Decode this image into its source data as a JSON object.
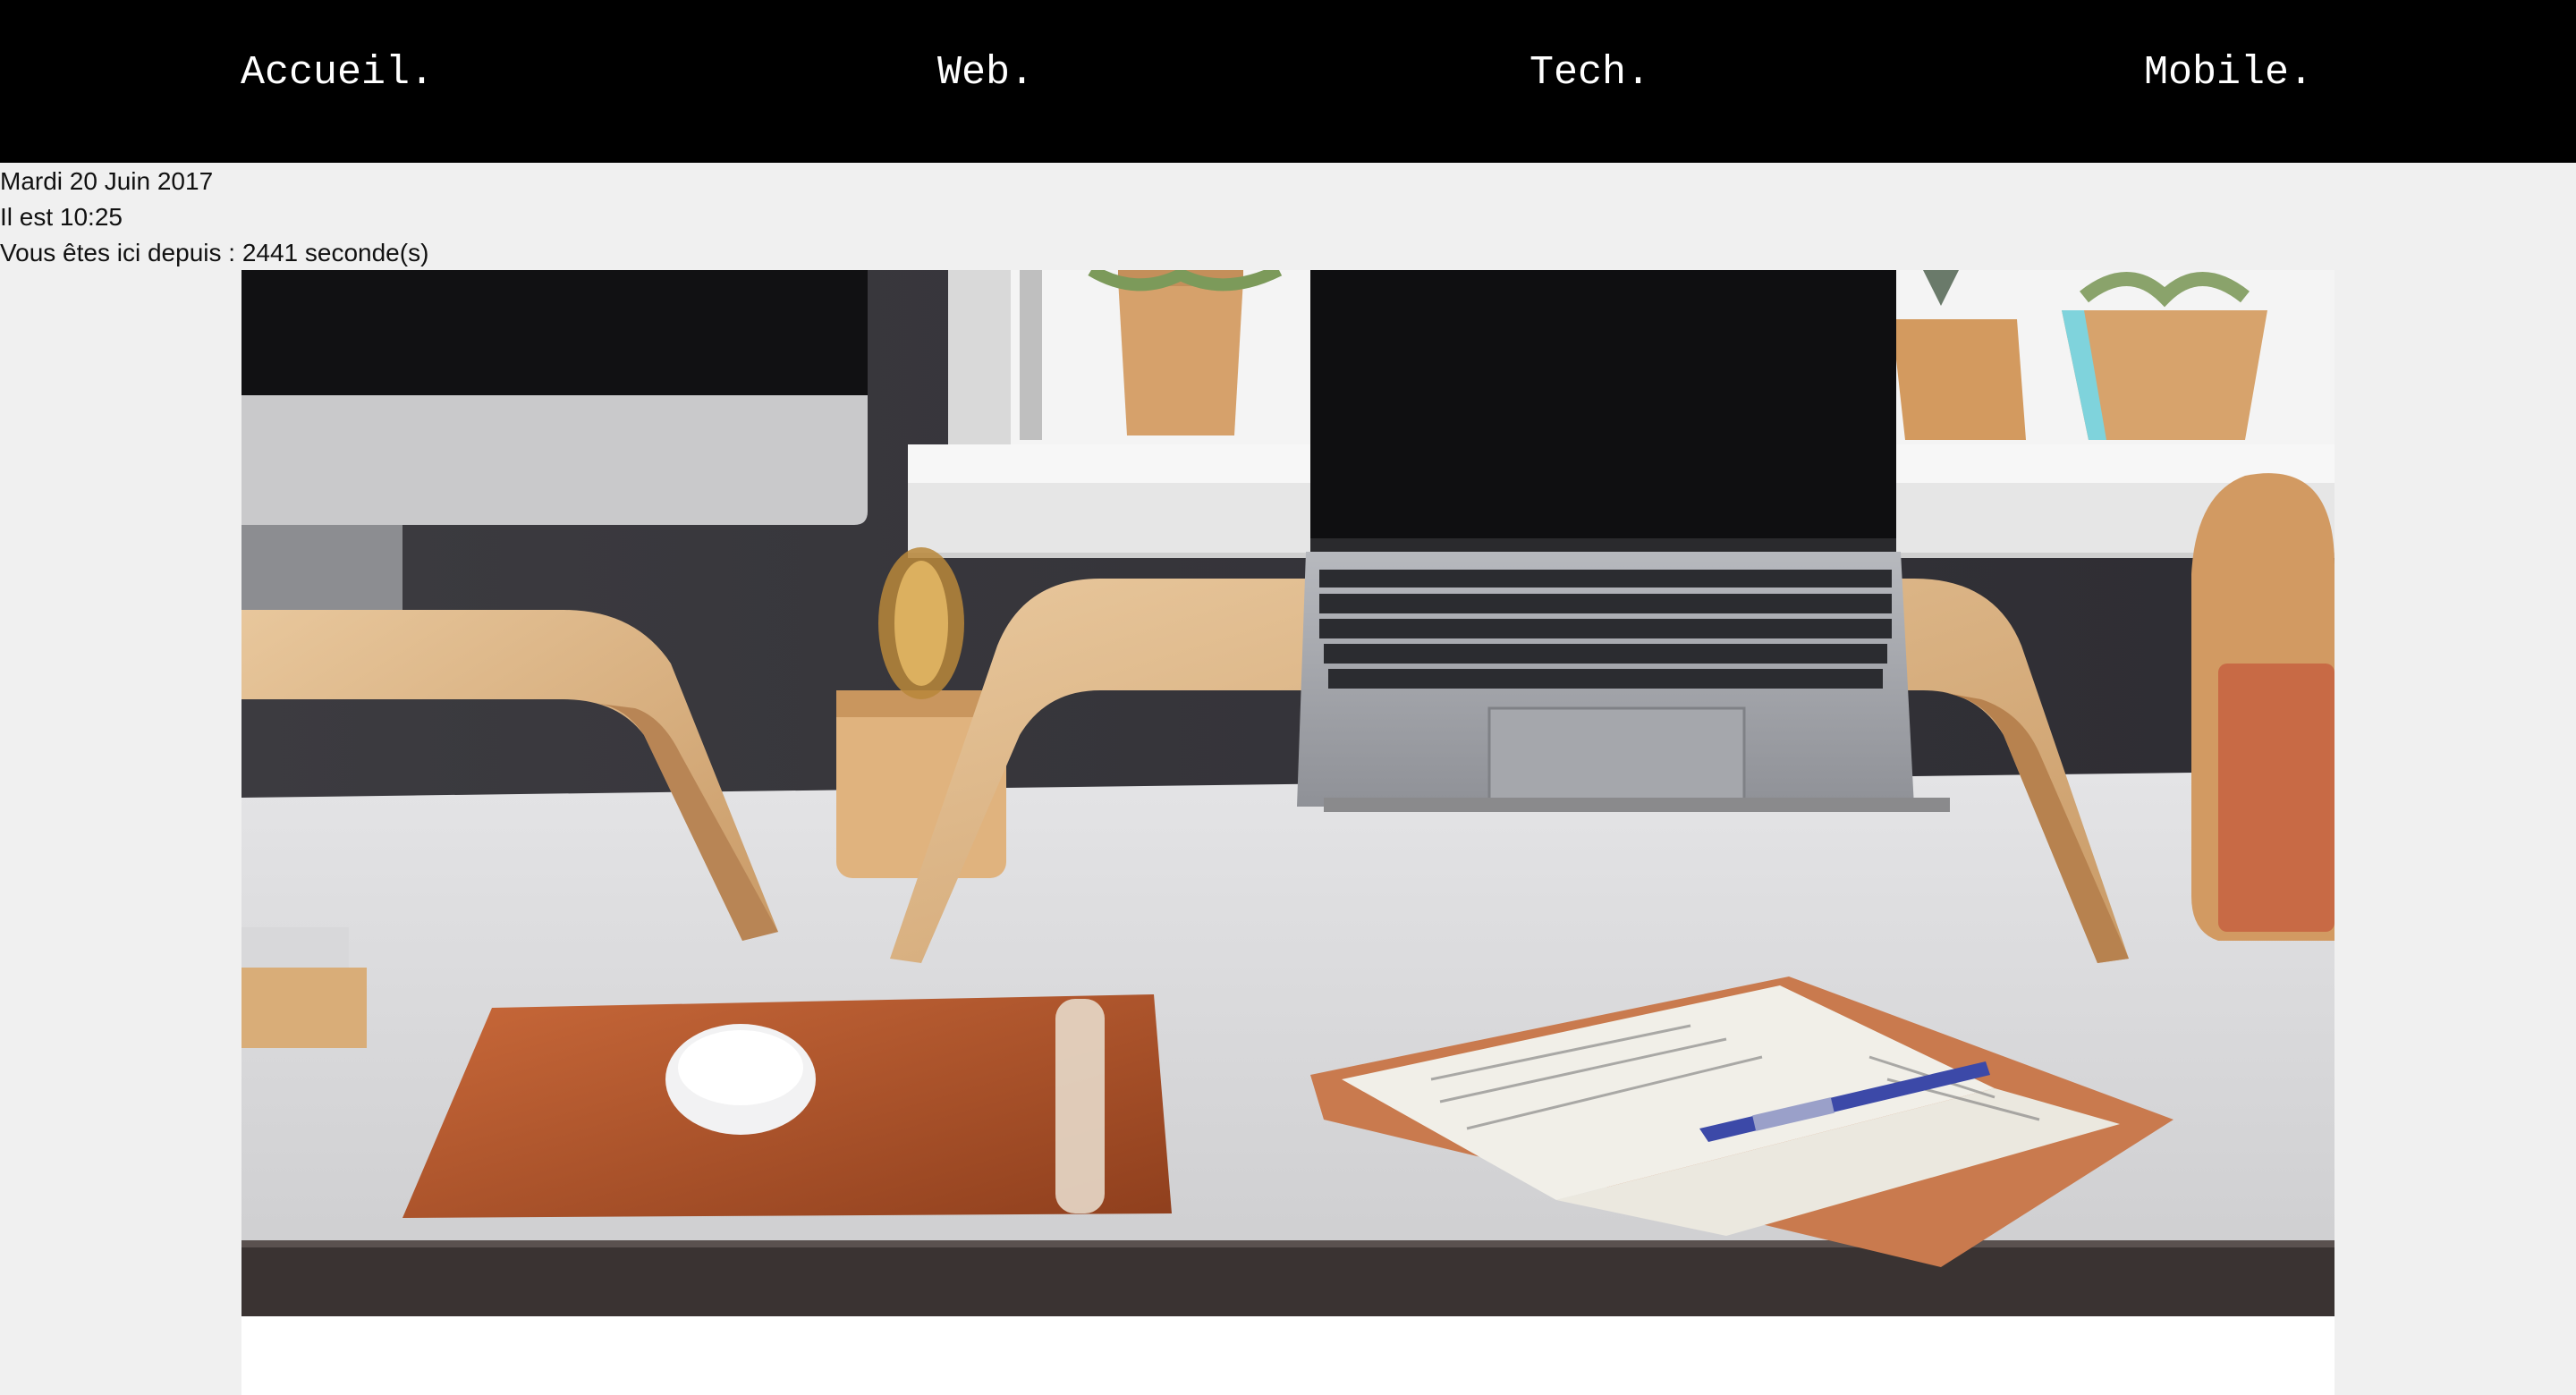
{
  "nav": {
    "items": [
      {
        "label": "Accueil."
      },
      {
        "label": "Web."
      },
      {
        "label": "Tech."
      },
      {
        "label": "Mobile."
      }
    ]
  },
  "info": {
    "date": "Mardi 20 Juin 2017",
    "time": "Il est 10:25",
    "timer": "Vous êtes ici depuis : 2441 seconde(s)"
  },
  "colors": {
    "nav_bg": "#000000",
    "nav_text": "#ffffff",
    "page_bg": "#f0f0f0"
  }
}
